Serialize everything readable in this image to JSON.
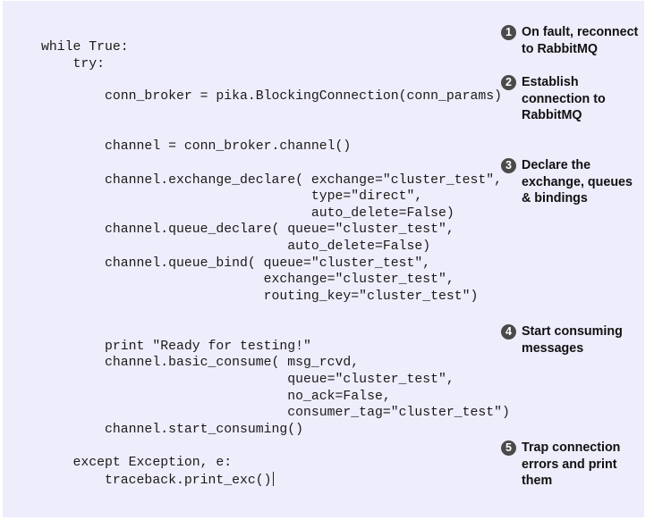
{
  "code_lines": [
    "while True:",
    "    try:",
    "        conn_broker = pika.BlockingConnection(conn_params)",
    "        channel = conn_broker.channel()",
    "        channel.exchange_declare( exchange=\"cluster_test\",",
    "                                  type=\"direct\",",
    "                                  auto_delete=False)",
    "        channel.queue_declare( queue=\"cluster_test\",",
    "                               auto_delete=False)",
    "        channel.queue_bind( queue=\"cluster_test\",",
    "                            exchange=\"cluster_test\",",
    "                            routing_key=\"cluster_test\")",
    "        print \"Ready for testing!\"",
    "        channel.basic_consume( msg_rcvd,",
    "                               queue=\"cluster_test\",",
    "                               no_ack=False,",
    "                               consumer_tag=\"cluster_test\")",
    "        channel.start_consuming()",
    "    except Exception, e:",
    "        traceback.print_exc()"
  ],
  "annotations": [
    {
      "number": "1",
      "text": "On fault, reconnect\nto RabbitMQ"
    },
    {
      "number": "2",
      "text": "Establish\nconnection to\nRabbitMQ"
    },
    {
      "number": "3",
      "text": "Declare the\nexchange, queues\n& bindings"
    },
    {
      "number": "4",
      "text": "Start consuming\nmessages"
    },
    {
      "number": "5",
      "text": "Trap connection\nerrors and print\nthem"
    }
  ],
  "colors": {
    "panel_background": "#eeedfb",
    "annotation_badge": "#4a4a4a"
  }
}
